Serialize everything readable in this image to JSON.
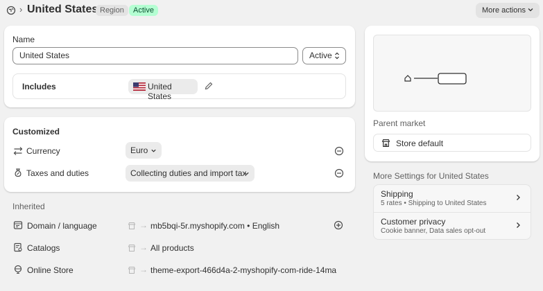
{
  "header": {
    "breadcrumb_separator": "›",
    "title": "United States",
    "badges": [
      "Region",
      "Active"
    ],
    "more_actions_label": "More actions"
  },
  "name_card": {
    "name_label": "Name",
    "name_value": "United States",
    "status_value": "Active",
    "includes_label": "Includes",
    "included_country": "United States"
  },
  "customized": {
    "title": "Customized",
    "rows": [
      {
        "icon": "currency-exchange-icon",
        "label": "Currency",
        "value": "Euro"
      },
      {
        "icon": "tax-bag-icon",
        "label": "Taxes and duties",
        "value": "Collecting duties and import tax"
      }
    ]
  },
  "inherited": {
    "title": "Inherited",
    "rows": [
      {
        "icon": "domain-language-icon",
        "label": "Domain / language",
        "value": "mb5bqi-5r.myshopify.com • English",
        "addable": true
      },
      {
        "icon": "catalog-icon",
        "label": "Catalogs",
        "value": "All products",
        "addable": false
      },
      {
        "icon": "online-store-icon",
        "label": "Online Store",
        "value": "theme-export-466d4a-2-myshopify-com-ride-14ma",
        "addable": false
      }
    ]
  },
  "right_panel": {
    "parent_market_label": "Parent market",
    "parent_market_value": "Store default",
    "more_settings_title": "More Settings for United States",
    "settings": [
      {
        "title": "Shipping",
        "subtitle": "5 rates • Shipping to United States"
      },
      {
        "title": "Customer privacy",
        "subtitle": "Cookie banner, Data sales opt-out"
      }
    ]
  },
  "colors": {
    "background": "#f1f1f1",
    "card": "#ffffff",
    "active_badge_bg": "#b4fed2",
    "active_badge_text": "#0c5132",
    "region_badge_bg": "#e3e3e3"
  }
}
